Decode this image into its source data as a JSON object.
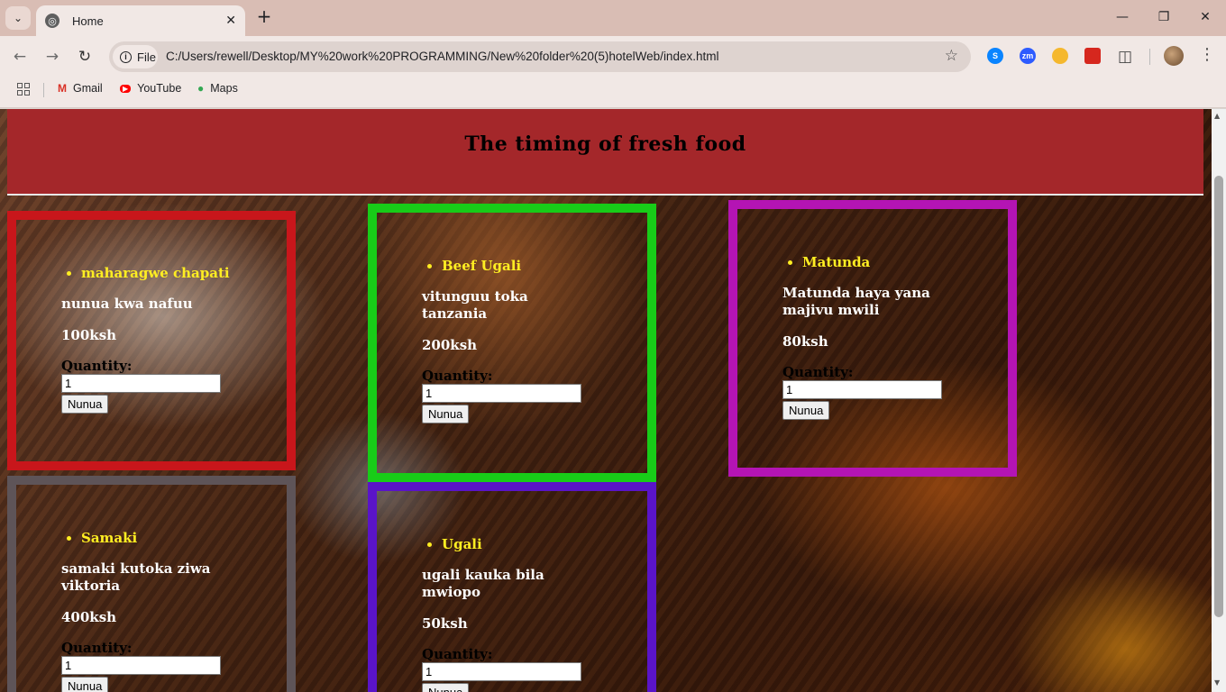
{
  "browser": {
    "tab_title": "Home",
    "site_chip": "File",
    "url": "C:/Users/rewell/Desktop/MY%20work%20PROGRAMMING/New%20folder%20(5)hotelWeb/index.html",
    "bookmarks": [
      {
        "label": "Gmail",
        "icon": "gmail-icon"
      },
      {
        "label": "YouTube",
        "icon": "youtube-icon"
      },
      {
        "label": "Maps",
        "icon": "maps-icon"
      }
    ],
    "extensions": [
      {
        "label": "S",
        "icon": "shazam-icon",
        "color": "#0a84ff"
      },
      {
        "label": "zm",
        "icon": "zoom-icon",
        "color": "#2d5bff"
      },
      {
        "label": "",
        "icon": "sun-extension-icon",
        "color": "#f5b82e"
      },
      {
        "label": "",
        "icon": "pdf-icon",
        "color": "#d6271e"
      }
    ]
  },
  "page": {
    "title": "The timing of fresh food",
    "colors": {
      "banner": "#a4272a",
      "accent_text": "#ffee22"
    },
    "cards": [
      {
        "name": "maharagwe chapati",
        "description": "nunua kwa nafuu",
        "price": "100ksh",
        "quantity_label": "Quantity:",
        "quantity_value": "1",
        "button": "Nunua",
        "border_color": "#c8161b"
      },
      {
        "name": "Beef Ugali",
        "description": "vitunguu toka tanzania",
        "price": "200ksh",
        "quantity_label": "Quantity:",
        "quantity_value": "1",
        "button": "Nunua",
        "border_color": "#18cc18"
      },
      {
        "name": "Matunda",
        "description": "Matunda haya yana majivu mwili",
        "price": "80ksh",
        "quantity_label": "Quantity:",
        "quantity_value": "1",
        "button": "Nunua",
        "border_color": "#b414b4"
      },
      {
        "name": "Samaki",
        "description": "samaki kutoka ziwa viktoria",
        "price": "400ksh",
        "quantity_label": "Quantity:",
        "quantity_value": "1",
        "button": "Nunua",
        "border_color": "#5e5458"
      },
      {
        "name": "Ugali",
        "description": "ugali kauka bila mwiopo",
        "price": "50ksh",
        "quantity_label": "Quantity:",
        "quantity_value": "1",
        "button": "Nunua",
        "border_color": "#5a14c8"
      }
    ]
  }
}
